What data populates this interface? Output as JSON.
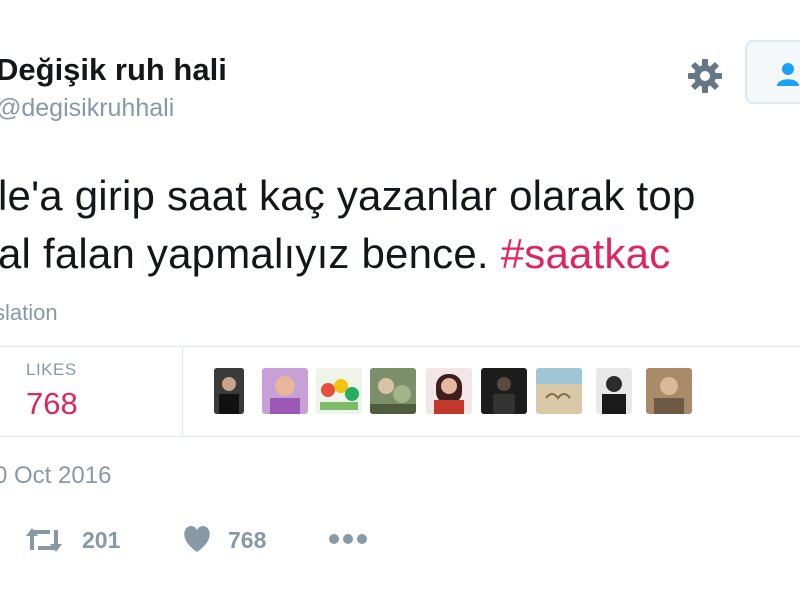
{
  "user": {
    "display_name": "Değişik ruh hali",
    "username": "@degisikruhhali"
  },
  "tweet": {
    "line1": "le'a girip saat kaç yazanlar olarak top",
    "line2_text": "al falan yapmalıyız bence. ",
    "hashtag": "#saatkac",
    "translate_label": "slation"
  },
  "stats": {
    "likes_label": "LIKES",
    "likes_count": "768"
  },
  "date": "0 Oct 2016",
  "actions": {
    "retweets": "201",
    "likes": "768"
  },
  "icons": [
    "gear-icon",
    "follow-person-icon",
    "retweet-icon",
    "heart-icon",
    "more-icon"
  ],
  "colors": {
    "hashtag": "#e0245e",
    "likes": "#e0245e",
    "muted": "#8899a6",
    "divider": "#e1e8ed"
  }
}
